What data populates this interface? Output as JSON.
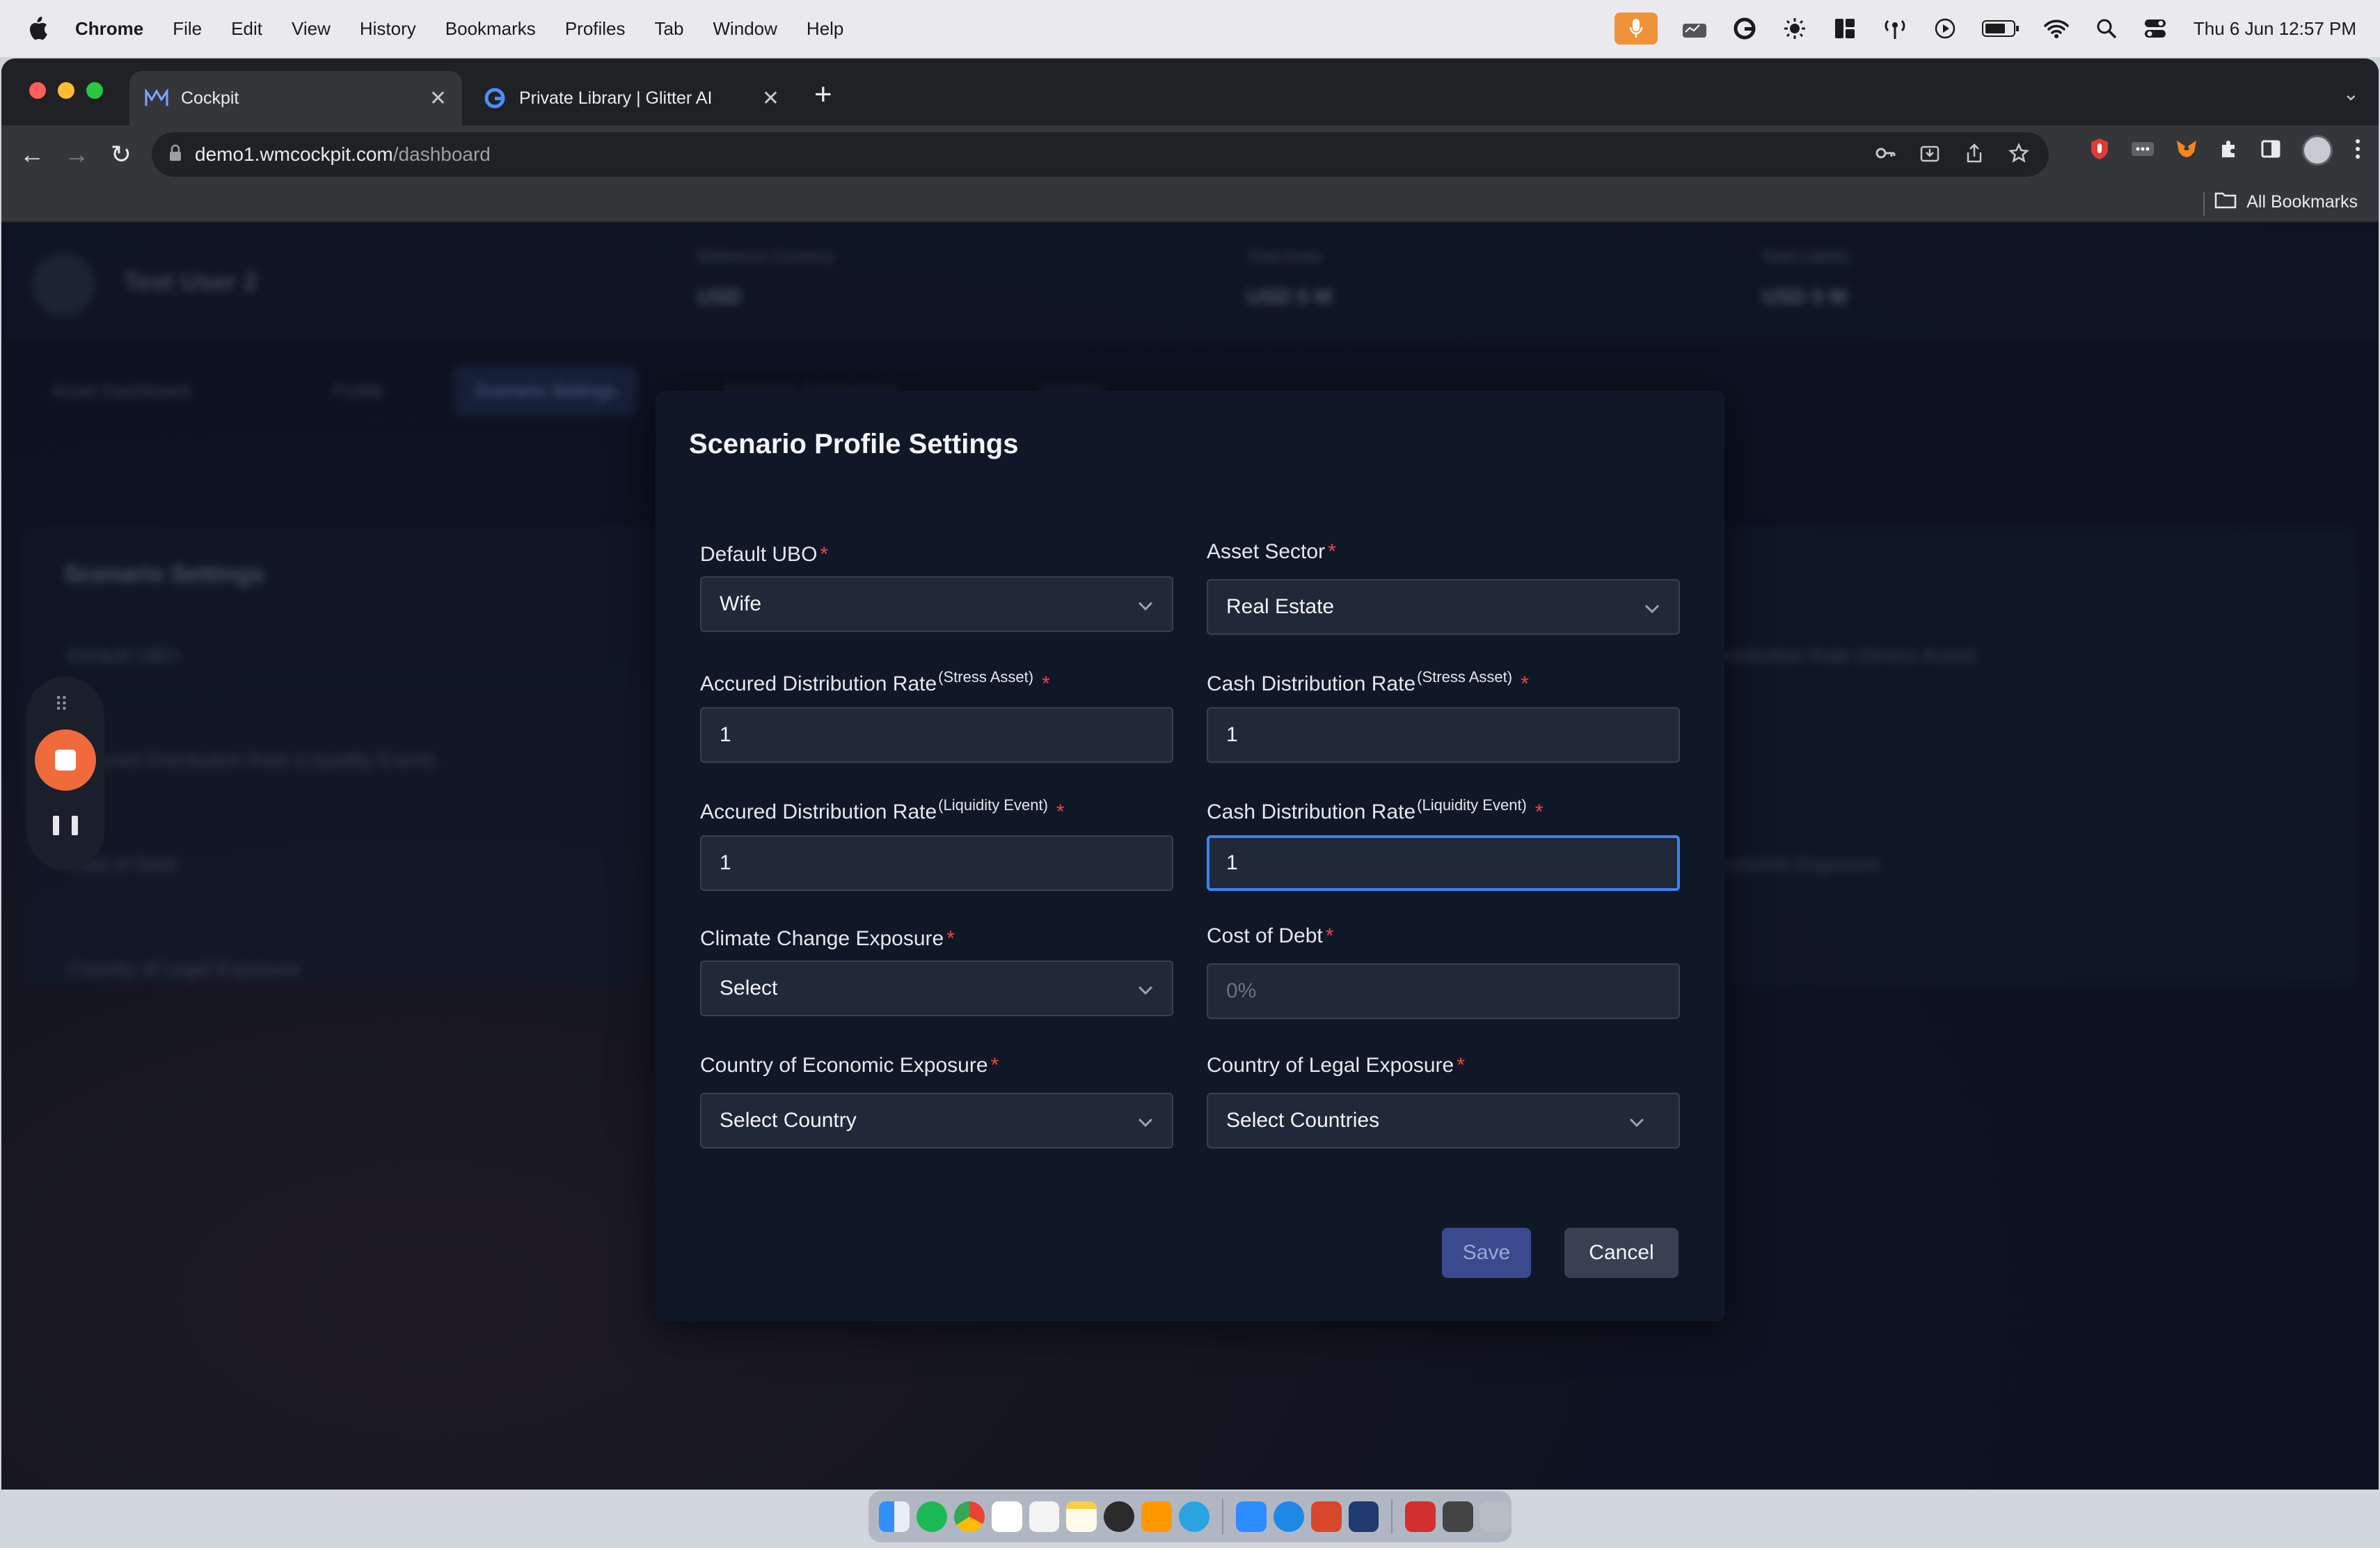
{
  "menubar": {
    "app_name": "Chrome",
    "menus": [
      "File",
      "Edit",
      "View",
      "History",
      "Bookmarks",
      "Profiles",
      "Tab",
      "Window",
      "Help"
    ],
    "clock": "Thu 6 Jun  12:57 PM",
    "status_icons": [
      "microphone-icon",
      "activity-monitor-icon",
      "grammarly-icon",
      "brightness-icon",
      "layout-icon",
      "antenna-icon",
      "play-icon",
      "battery-icon",
      "wifi-icon",
      "spotlight-search-icon",
      "control-center-icon"
    ]
  },
  "browser": {
    "tabs": [
      {
        "title": "Cockpit",
        "active": true
      },
      {
        "title": "Private Library | Glitter AI",
        "active": false
      }
    ],
    "url_host": "demo1.wmcockpit.com",
    "url_path": "/dashboard",
    "bookmarks_label": "All Bookmarks"
  },
  "background": {
    "user_name": "Test User 2",
    "stats": [
      {
        "label": "Reference Currency",
        "value": "USD"
      },
      {
        "label": "Total Asset",
        "value": "USD 5 M"
      },
      {
        "label": "Total Liability",
        "value": "USD 0 M"
      }
    ],
    "tabs": [
      "Asset Dashboard",
      "Profile",
      "Scenario Settings",
      "Scenario Comparison",
      "Insights"
    ],
    "card_title": "Scenario Settings",
    "card_fields": [
      "Default UBO",
      "Accured Distribution Rate (Liquidity Event)",
      "Cost of Debt",
      "Country of Legal Exposure",
      "Distribution Rate (Stress Asset)",
      "Economic Exposure"
    ]
  },
  "modal": {
    "title": "Scenario Profile Settings",
    "required_mark": "*",
    "fields": {
      "default_ubo": {
        "label": "Default UBO",
        "value": "Wife"
      },
      "asset_sector": {
        "label": "Asset Sector",
        "value": "Real Estate"
      },
      "accured_stress": {
        "label": "Accured Distribution Rate",
        "sup": "(Stress Asset)",
        "value": "1"
      },
      "cash_stress": {
        "label": "Cash Distribution Rate",
        "sup": "(Stress Asset)",
        "value": "1"
      },
      "accured_liquidity": {
        "label": "Accured Distribution Rate",
        "sup": "(Liquidity Event)",
        "value": "1"
      },
      "cash_liquidity": {
        "label": "Cash Distribution Rate",
        "sup": "(Liquidity Event)",
        "value": "1"
      },
      "climate": {
        "label": "Climate Change Exposure",
        "value": "Select"
      },
      "cost_of_debt": {
        "label": "Cost of Debt",
        "placeholder": "0%"
      },
      "economic_country": {
        "label": "Country of Economic Exposure",
        "value": "Select Country"
      },
      "legal_country": {
        "label": "Country of Legal Exposure",
        "value": "Select Countries"
      }
    },
    "save_label": "Save",
    "cancel_label": "Cancel"
  },
  "colors": {
    "accent": "#3b82f6",
    "required": "#ef4444",
    "record": "#f06a3c",
    "modal_bg": "#101828"
  }
}
